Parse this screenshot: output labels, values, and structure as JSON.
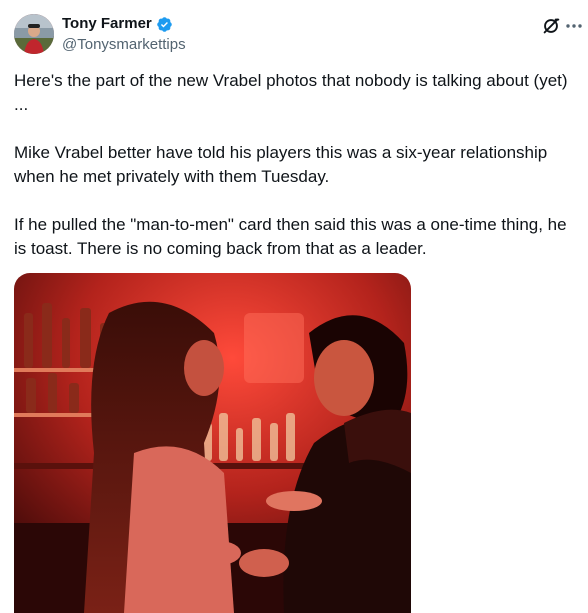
{
  "author": {
    "name": "Tony Farmer",
    "handle": "@Tonysmarkettips",
    "avatar_icon": "avatar",
    "verified_icon": "verified-badge-icon",
    "verified_color": "#1d9bf0"
  },
  "actions": {
    "grok_icon": "grok-icon",
    "more_icon": "more-options-icon"
  },
  "tweet": {
    "paragraphs": [
      "Here's the part of the new Vrabel photos that nobody is talking about (yet) ...",
      "Mike Vrabel better have told his players this was a six-year relationship when he met privately with them Tuesday.",
      "If he pulled the \"man-to-men\" card then said this was a one-time thing, he is toast. There is no coming back from that as a leader."
    ]
  },
  "media": {
    "type": "photo",
    "dominant_color": "#c0302a"
  },
  "colors": {
    "text_primary": "#0f1419",
    "text_secondary": "#536471",
    "accent": "#1d9bf0"
  }
}
